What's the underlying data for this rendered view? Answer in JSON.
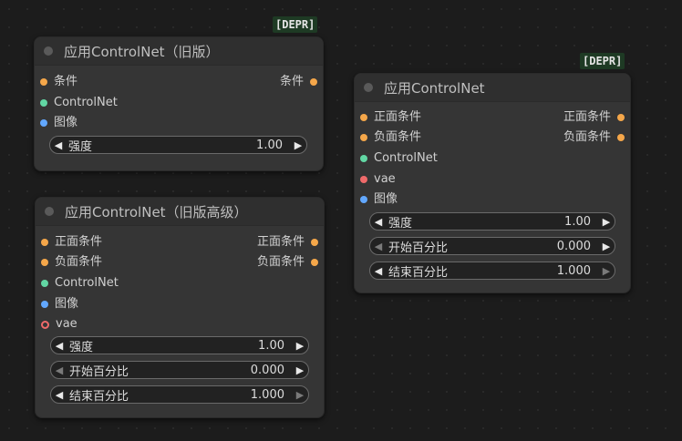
{
  "badge": "[DEPR]",
  "nodes": {
    "a": {
      "title": "应用ControlNet（旧版）",
      "inputs": [
        "条件",
        "ControlNet",
        "图像"
      ],
      "outputs": [
        "条件"
      ],
      "widgets": [
        {
          "label": "强度",
          "value": "1.00"
        }
      ]
    },
    "b": {
      "title": "应用ControlNet（旧版高级）",
      "inputs": [
        "正面条件",
        "负面条件",
        "ControlNet",
        "图像",
        "vae"
      ],
      "outputs": [
        "正面条件",
        "负面条件"
      ],
      "widgets": [
        {
          "label": "强度",
          "value": "1.00"
        },
        {
          "label": "开始百分比",
          "value": "0.000"
        },
        {
          "label": "结束百分比",
          "value": "1.000"
        }
      ]
    },
    "c": {
      "title": "应用ControlNet",
      "inputs": [
        "正面条件",
        "负面条件",
        "ControlNet",
        "vae",
        "图像"
      ],
      "outputs": [
        "正面条件",
        "负面条件"
      ],
      "widgets": [
        {
          "label": "强度",
          "value": "1.00"
        },
        {
          "label": "开始百分比",
          "value": "0.000"
        },
        {
          "label": "结束百分比",
          "value": "1.000"
        }
      ]
    }
  },
  "icons": {
    "left_arrow": "◀",
    "right_arrow": "▶"
  },
  "colors": {
    "conditioning": "#f5a74a",
    "controlnet": "#62d7a4",
    "image": "#62a8ff",
    "vae": "#ef6a6a",
    "badge_bg": "#1e3a24"
  }
}
